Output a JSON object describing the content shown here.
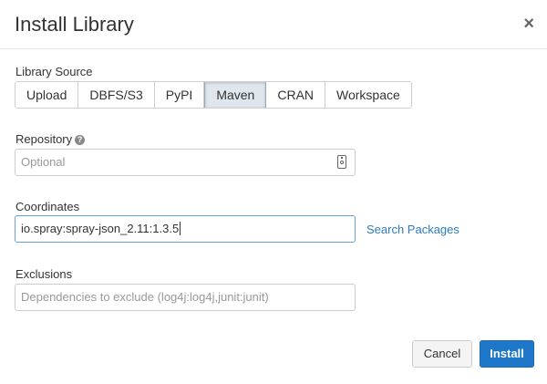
{
  "dialog": {
    "title": "Install Library",
    "close_glyph": "×"
  },
  "library_source": {
    "label": "Library Source",
    "options": [
      "Upload",
      "DBFS/S3",
      "PyPI",
      "Maven",
      "CRAN",
      "Workspace"
    ],
    "selected": "Maven"
  },
  "repository": {
    "label": "Repository",
    "help_glyph": "?",
    "placeholder": "Optional",
    "value": "",
    "icon": "repository-picker-icon"
  },
  "coordinates": {
    "label": "Coordinates",
    "value": "io.spray:spray-json_2.11:1.3.5",
    "search_link": "Search Packages"
  },
  "exclusions": {
    "label": "Exclusions",
    "placeholder": "Dependencies to exclude (log4j:log4j,junit:junit)",
    "value": ""
  },
  "footer": {
    "cancel_label": "Cancel",
    "install_label": "Install"
  },
  "colors": {
    "primary": "#1f77c9",
    "link": "#2f7bbf",
    "selected_segment": "#dfe6ec"
  }
}
